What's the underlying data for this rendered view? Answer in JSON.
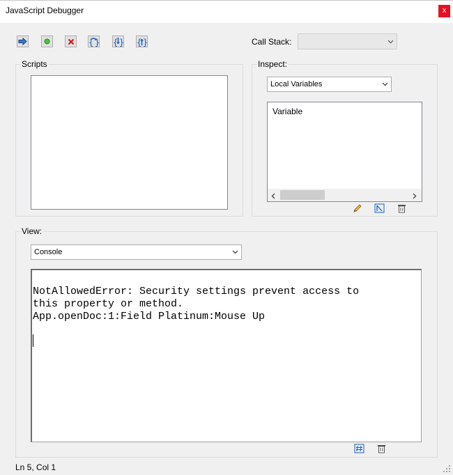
{
  "window": {
    "title": "JavaScript Debugger",
    "close_glyph": "x"
  },
  "toolbar": {
    "buttons": [
      {
        "name": "resume",
        "icon": "arrow-right-icon"
      },
      {
        "name": "interrupt",
        "icon": "green-dot-icon"
      },
      {
        "name": "quit",
        "icon": "red-x-icon"
      },
      {
        "name": "step-over",
        "icon": "step-over-icon"
      },
      {
        "name": "step-into",
        "icon": "step-into-icon"
      },
      {
        "name": "step-out",
        "icon": "step-out-icon"
      }
    ]
  },
  "call_stack": {
    "label": "Call Stack:",
    "value": ""
  },
  "scripts": {
    "label": "Scripts"
  },
  "inspect": {
    "label": "Inspect:",
    "selected": "Local Variables",
    "column_header": "Variable"
  },
  "view": {
    "label": "View:",
    "selected": "Console",
    "console_lines": [
      "NotAllowedError: Security settings prevent access to",
      "this property or method.",
      "App.openDoc:1:Field Platinum:Mouse Up"
    ]
  },
  "status": {
    "position": "Ln 5, Col 1"
  },
  "colors": {
    "close": "#e81123",
    "panel_bg": "#f0f0f0",
    "icon_blue": "#1c5fb7"
  }
}
